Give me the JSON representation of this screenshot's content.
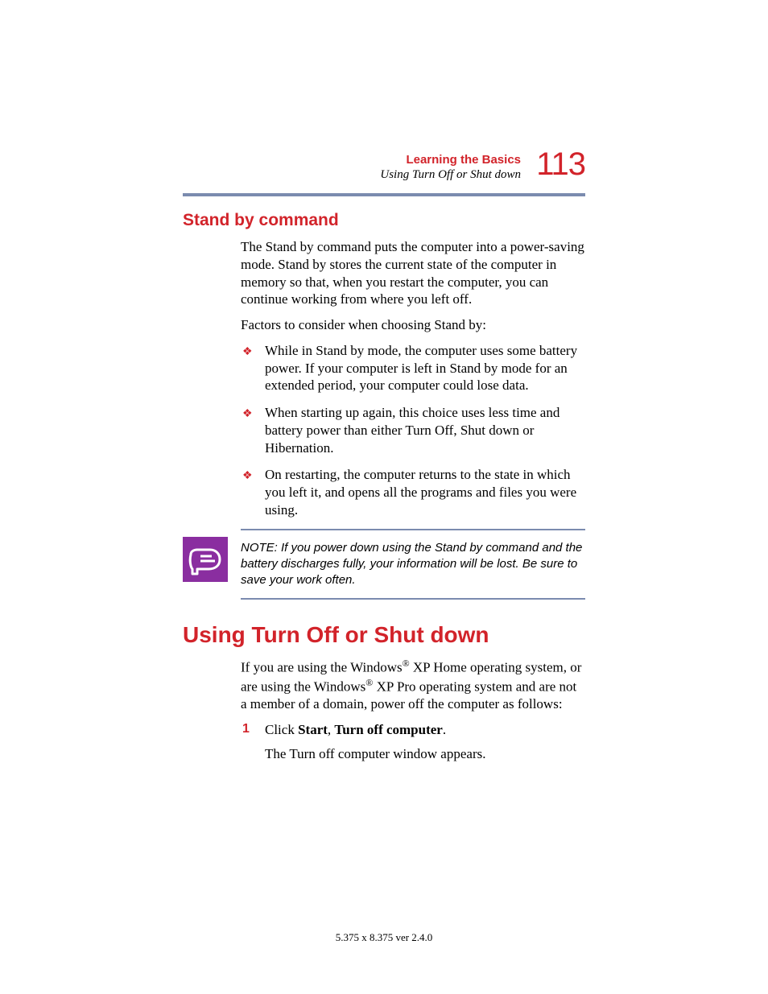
{
  "header": {
    "chapter": "Learning the Basics",
    "sectionRef": "Using Turn Off or Shut down",
    "pageNumber": "113"
  },
  "standby": {
    "heading": "Stand by command",
    "para1": "The Stand by command puts the computer into a power-saving mode. Stand by stores the current state of the computer in memory so that, when you restart the computer, you can continue working from where you left off.",
    "para2": "Factors to consider when choosing Stand by:",
    "bullets": [
      "While in Stand by mode, the computer uses some battery power. If your computer is left in Stand by mode for an extended period, your computer could lose data.",
      "When starting up again, this choice uses less time and battery power than either Turn Off, Shut down or Hibernation.",
      "On restarting, the computer returns to the state in which you left it, and opens all the programs and files you were using."
    ]
  },
  "note": {
    "text": "NOTE: If you power down using the Stand by command and the battery discharges fully, your information will be lost. Be sure to save your work often."
  },
  "turnoff": {
    "heading": "Using Turn Off or Shut down",
    "intro_pre": "If you are using the Windows",
    "intro_mid1": " XP Home operating system, or are using the Windows",
    "intro_mid2": " XP Pro operating system and are not a member of a domain, power off the computer as follows:",
    "reg": "®",
    "step1_num": "1",
    "step1_a": "Click ",
    "step1_b": "Start",
    "step1_c": ", ",
    "step1_d": "Turn off computer",
    "step1_e": ".",
    "step1_result": "The Turn off computer window appears."
  },
  "footer": "5.375 x 8.375 ver 2.4.0"
}
